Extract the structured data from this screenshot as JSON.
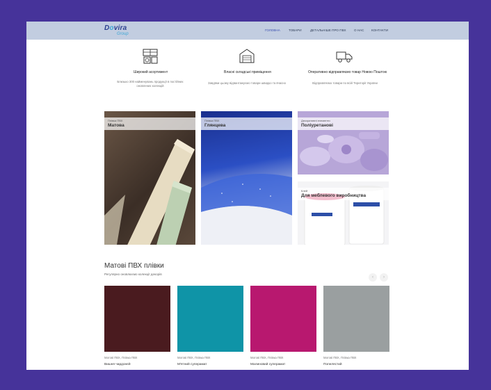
{
  "header": {
    "logo_main_a": "D",
    "logo_main_o": "o",
    "logo_main_b": "vira",
    "logo_sub": "Group",
    "nav": [
      "ГОЛОВНА",
      "ТОВАРИ",
      "ДЕТАЛЬНІШЕ ПРО ПВХ",
      "О НАС",
      "КОНТАКТИ"
    ]
  },
  "features": [
    {
      "icon": "shelves-icon",
      "title": "Широкий асортимент",
      "desc_1": "Близько 300 найменувань продукції в постійних",
      "desc_2": "оновлених колекцій"
    },
    {
      "icon": "warehouse-icon",
      "title": "Власні складські приміщення",
      "desc_1": "Завдяки цьому відвантажуємо товари швидко та вчасно",
      "desc_2": ""
    },
    {
      "icon": "delivery-truck-icon",
      "title": "Оперативно відправляємо товар Новою Поштою",
      "desc_1": "Відправляємо товари по всій Території України",
      "desc_2": ""
    }
  ],
  "categories": [
    {
      "small": "Плівка ПВХ",
      "name": "Матова"
    },
    {
      "small": "Плівка ПВХ",
      "name": "Глянцева"
    },
    {
      "small": "Декоративні елементи",
      "name": "Поліуретанові"
    },
    {
      "small": "Клей",
      "name": "Для меблевого виробництва"
    }
  ],
  "section": {
    "title": "Матові ПВХ плівки",
    "subtitle": "Регулярно оновлюємо колекції декорів",
    "prev": "‹",
    "next": "›"
  },
  "products": [
    {
      "category": "Матові ПВХ, Плівка ПВХ",
      "name": "Вишня чардоней",
      "color": "#4a1b1f"
    },
    {
      "category": "Матові ПВХ, Плівка ПВХ",
      "name": "М'ятний суперамат",
      "color": "#0f94a7"
    },
    {
      "category": "Матові ПВХ, Плівка ПВХ",
      "name": "Малиновий суперамат",
      "color": "#b8186f"
    },
    {
      "category": "Матові ПВХ, Плівка ПВХ",
      "name": "Попелястий",
      "color": "#9a9fa0"
    }
  ],
  "colors": {
    "background": "#46339a",
    "topbar": "#c2cde0",
    "accent": "#3a4fb0"
  }
}
